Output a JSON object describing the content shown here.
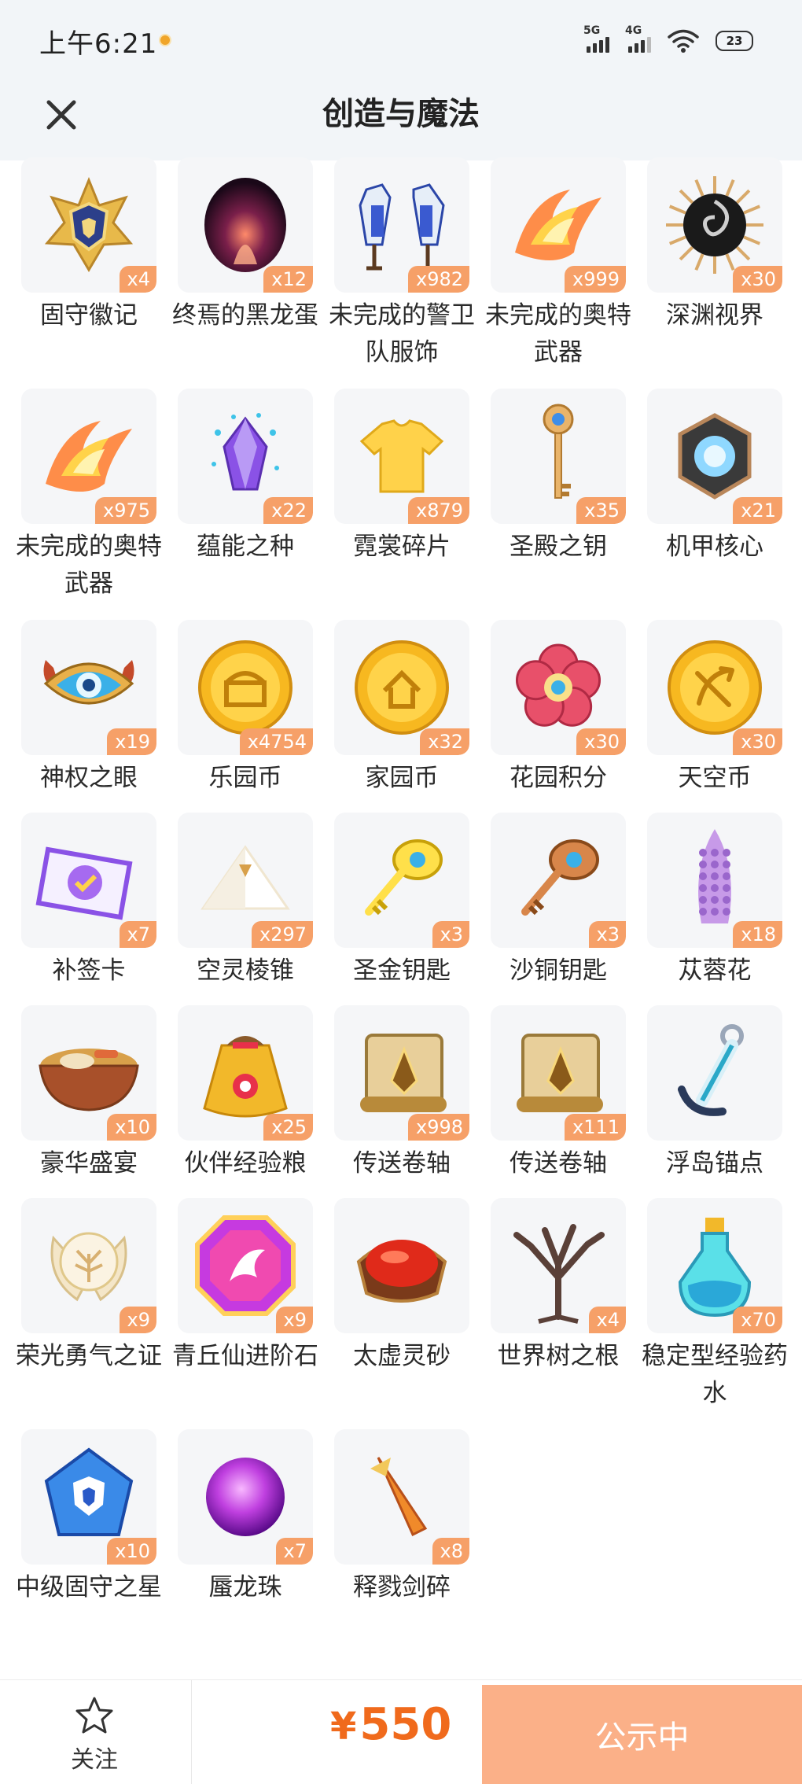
{
  "status": {
    "time": "上午6:21",
    "signal_1_label": "5G",
    "signal_2_label": "4G",
    "battery": "23"
  },
  "header": {
    "title": "创造与魔法",
    "close_icon": "close-icon"
  },
  "items": [
    {
      "name": "固守徽记",
      "count": "x4",
      "icon": "shield-badge-icon"
    },
    {
      "name": "终焉的黑龙蛋",
      "count": "x12",
      "icon": "dragon-egg-icon"
    },
    {
      "name": "未完成的警卫队服饰",
      "count": "x982",
      "icon": "guard-outfit-icon"
    },
    {
      "name": "未完成的奥特武器",
      "count": "x999",
      "icon": "flame-weapon-icon"
    },
    {
      "name": "深渊视界",
      "count": "x30",
      "icon": "abyss-eye-icon"
    },
    {
      "name": "未完成的奥特武器",
      "count": "x975",
      "icon": "flame-weapon-icon"
    },
    {
      "name": "蕴能之种",
      "count": "x22",
      "icon": "crystal-seed-icon"
    },
    {
      "name": "霓裳碎片",
      "count": "x879",
      "icon": "tshirt-icon"
    },
    {
      "name": "圣殿之钥",
      "count": "x35",
      "icon": "temple-key-icon"
    },
    {
      "name": "机甲核心",
      "count": "x21",
      "icon": "mech-core-icon"
    },
    {
      "name": "神权之眼",
      "count": "x19",
      "icon": "divine-eye-icon"
    },
    {
      "name": "乐园币",
      "count": "x4754",
      "icon": "paradise-coin-icon"
    },
    {
      "name": "家园币",
      "count": "x32",
      "icon": "home-coin-icon"
    },
    {
      "name": "花园积分",
      "count": "x30",
      "icon": "flower-token-icon"
    },
    {
      "name": "天空币",
      "count": "x30",
      "icon": "sky-coin-icon"
    },
    {
      "name": "补签卡",
      "count": "x7",
      "icon": "ticket-card-icon"
    },
    {
      "name": "空灵棱锥",
      "count": "x297",
      "icon": "pyramid-icon"
    },
    {
      "name": "圣金钥匙",
      "count": "x3",
      "icon": "gold-key-icon"
    },
    {
      "name": "沙铜钥匙",
      "count": "x3",
      "icon": "bronze-key-icon"
    },
    {
      "name": "苁蓉花",
      "count": "x18",
      "icon": "cistanche-flower-icon"
    },
    {
      "name": "豪华盛宴",
      "count": "x10",
      "icon": "feast-bowl-icon"
    },
    {
      "name": "伙伴经验粮",
      "count": "x25",
      "icon": "food-bag-icon"
    },
    {
      "name": "传送卷轴",
      "count": "x998",
      "icon": "scroll-icon"
    },
    {
      "name": "传送卷轴",
      "count": "x111",
      "icon": "scroll-icon"
    },
    {
      "name": "浮岛锚点",
      "count": "",
      "icon": "anchor-icon"
    },
    {
      "name": "荣光勇气之证",
      "count": "x9",
      "icon": "tree-emblem-icon"
    },
    {
      "name": "青丘仙进阶石",
      "count": "x9",
      "icon": "fox-gem-icon"
    },
    {
      "name": "太虚灵砂",
      "count": "",
      "icon": "red-sand-icon"
    },
    {
      "name": "世界树之根",
      "count": "x4",
      "icon": "tree-root-icon"
    },
    {
      "name": "稳定型经验药水",
      "count": "x70",
      "icon": "potion-icon"
    },
    {
      "name": "中级固守之星",
      "count": "x10",
      "icon": "blue-star-icon"
    },
    {
      "name": "蜃龙珠",
      "count": "x7",
      "icon": "purple-orb-icon"
    },
    {
      "name": "释戮剑碎",
      "count": "x8",
      "icon": "sword-shard-icon"
    }
  ],
  "bottom": {
    "follow_label": "关注",
    "follow_icon": "star-outline-icon",
    "price_symbol": "¥",
    "price": "550",
    "cta_label": "公示中"
  },
  "colors": {
    "badge": "#f6a068",
    "price": "#f06a1c",
    "cta": "#fbb088",
    "header_bg": "#f2f5f8"
  }
}
